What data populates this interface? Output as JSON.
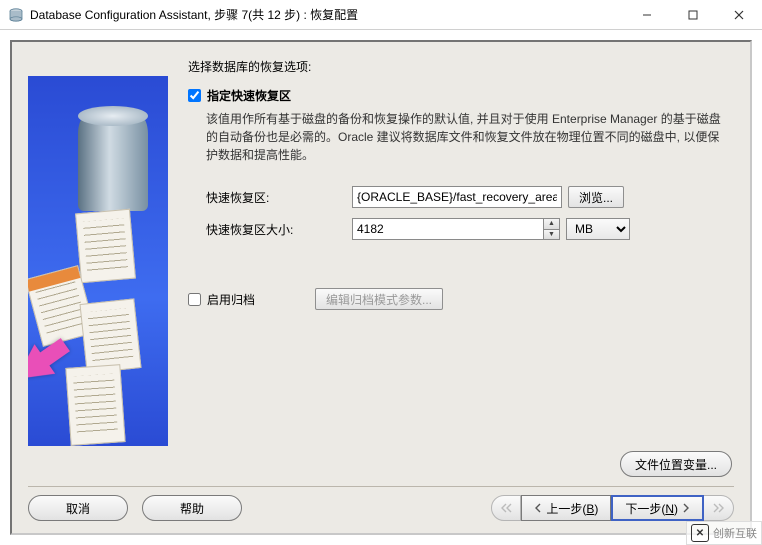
{
  "window": {
    "title": "Database Configuration Assistant, 步骤 7(共 12 步) : 恢复配置"
  },
  "section": {
    "prompt": "选择数据库的恢复选项:",
    "fra_checkbox_label": "指定快速恢复区",
    "fra_checked": true,
    "fra_description": "该值用作所有基于磁盘的备份和恢复操作的默认值, 并且对于使用 Enterprise Manager 的基于磁盘的自动备份也是必需的。Oracle 建议将数据库文件和恢复文件放在物理位置不同的磁盘中, 以便保护数据和提高性能。"
  },
  "fields": {
    "fra_path_label": "快速恢复区:",
    "fra_path_value": "{ORACLE_BASE}/fast_recovery_area",
    "browse_label": "浏览...",
    "fra_size_label": "快速恢复区大小:",
    "fra_size_value": "4182",
    "fra_size_unit": "MB"
  },
  "archive": {
    "enable_label": "启用归档",
    "enable_checked": false,
    "edit_params_label": "编辑归档模式参数..."
  },
  "buttons": {
    "file_loc_vars": "文件位置变量...",
    "cancel": "取消",
    "help": "帮助",
    "back_prefix": "上一步(",
    "back_key": "B",
    "back_suffix": ")",
    "next_prefix": "下一步(",
    "next_key": "N",
    "next_suffix": ")"
  },
  "watermark": {
    "text": "创新互联"
  }
}
